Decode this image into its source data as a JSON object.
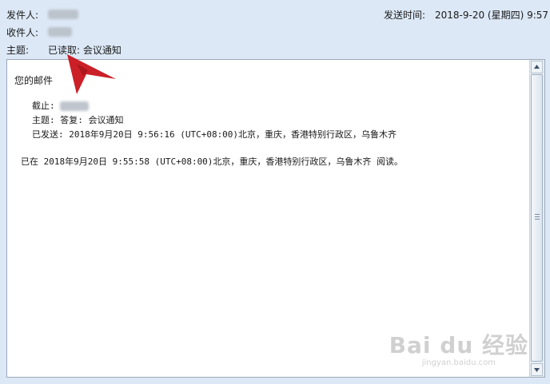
{
  "header": {
    "from_label": "发件人:",
    "to_label": "收件人:",
    "subject_label": "主题:",
    "subject_value": "已读取: 会议通知",
    "sent_label": "发送时间:",
    "sent_value": "2018-9-20 (星期四) 9:57"
  },
  "message": {
    "greeting": "您的邮件",
    "to_label": "截止:",
    "subject_line": "主题: 答复: 会议通知",
    "sent_line": "已发送: 2018年9月20日 9:56:16 (UTC+08:00)北京，重庆，香港特别行政区，乌鲁木齐",
    "read_line": "已在 2018年9月20日 9:55:58 (UTC+08:00)北京，重庆，香港特别行政区，乌鲁木齐 阅读。"
  },
  "watermark": {
    "logo": "Bai du 经验",
    "url": "jingyan.baidu.com"
  },
  "colors": {
    "header_bg": "#dce8f6",
    "arrow": "#c8141c"
  },
  "icons": [
    "scroll-up-icon",
    "scroll-down-icon",
    "red-arrow-annotation"
  ]
}
